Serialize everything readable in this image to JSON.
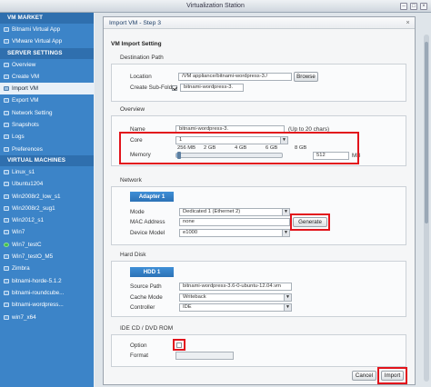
{
  "window": {
    "title": "Virtualization Station"
  },
  "sidebar": {
    "sections": [
      {
        "title": "VM MARKET",
        "items": [
          {
            "label": "Bitnami Virtual App",
            "selected": false,
            "running": false
          },
          {
            "label": "VMware Virtual App",
            "selected": false,
            "running": false
          }
        ]
      },
      {
        "title": "SERVER SETTINGS",
        "items": [
          {
            "label": "Overview",
            "selected": false,
            "running": false
          },
          {
            "label": "Create VM",
            "selected": false,
            "running": false
          },
          {
            "label": "Import VM",
            "selected": true,
            "running": false
          },
          {
            "label": "Export VM",
            "selected": false,
            "running": false
          },
          {
            "label": "Network Setting",
            "selected": false,
            "running": false
          },
          {
            "label": "Snapshots",
            "selected": false,
            "running": false
          },
          {
            "label": "Logs",
            "selected": false,
            "running": false
          },
          {
            "label": "Preferences",
            "selected": false,
            "running": false
          }
        ]
      },
      {
        "title": "VIRTUAL MACHINES",
        "items": [
          {
            "label": "Linux_s1",
            "selected": false,
            "running": false
          },
          {
            "label": "Ubuntu1204",
            "selected": false,
            "running": false
          },
          {
            "label": "Win2008r2_low_s1",
            "selected": false,
            "running": false
          },
          {
            "label": "Win2008r2_sug1",
            "selected": false,
            "running": false
          },
          {
            "label": "Win2012_s1",
            "selected": false,
            "running": false
          },
          {
            "label": "Win7",
            "selected": false,
            "running": false
          },
          {
            "label": "Win7_testC",
            "selected": false,
            "running": true
          },
          {
            "label": "Win7_testO_M5",
            "selected": false,
            "running": false
          },
          {
            "label": "Zimbra",
            "selected": false,
            "running": false
          },
          {
            "label": "bitnami-horde-5.1.2",
            "selected": false,
            "running": false
          },
          {
            "label": "bitnami-roundcube...",
            "selected": false,
            "running": false
          },
          {
            "label": "bitnami-wordpress...",
            "selected": false,
            "running": false
          },
          {
            "label": "win7_x64",
            "selected": false,
            "running": false
          }
        ]
      }
    ]
  },
  "dialog": {
    "title": "Import VM - Step 3",
    "heading": "VM Import Setting",
    "destination": {
      "section": "Destination Path",
      "location_label": "Location",
      "location_value": "/VM appliance/bitnami-wordpress-3./",
      "browse_label": "Browse",
      "create_subfolder_label": "Create Sub-Folder",
      "create_subfolder_checked": true,
      "subfolder_value": "bitnami-wordpress-3."
    },
    "overview": {
      "section": "Overview",
      "name_label": "Name",
      "name_value": "bitnami-wordpress-3.",
      "name_hint": "(Up to 20 chars)",
      "core_label": "Core",
      "core_value": "1",
      "memory_label": "Memory",
      "memory_ticks": [
        "256 MB",
        "2 GB",
        "4 GB",
        "6 GB",
        "8 GB"
      ],
      "memory_value": "512",
      "memory_unit": "MB",
      "memory_fraction": 0.03
    },
    "network": {
      "section": "Network",
      "tab": "Adapter 1",
      "mode_label": "Mode",
      "mode_value": "Dedicated 1 (Ethernet 2)",
      "mac_label": "MAC Address",
      "mac_value": "none",
      "generate_label": "Generate",
      "device_label": "Device Model",
      "device_value": "e1000"
    },
    "harddisk": {
      "section": "Hard Disk",
      "tab": "HDD 1",
      "source_label": "Source Path",
      "source_value": "bitnami-wordpress-3.6-0-ubuntu-12.04.vm",
      "cache_label": "Cache Mode",
      "cache_value": "Writeback",
      "controller_label": "Controller",
      "controller_value": "IDE"
    },
    "cdrom": {
      "section": "IDE CD / DVD ROM",
      "option_label": "Option",
      "option_checked": false,
      "format_label": "Format",
      "format_value": ""
    },
    "cancel_label": "Cancel",
    "import_label": "Import"
  },
  "colors": {
    "sidebar": "#3c84c8",
    "highlight": "#e2141c",
    "tab": "#2c72b6"
  }
}
